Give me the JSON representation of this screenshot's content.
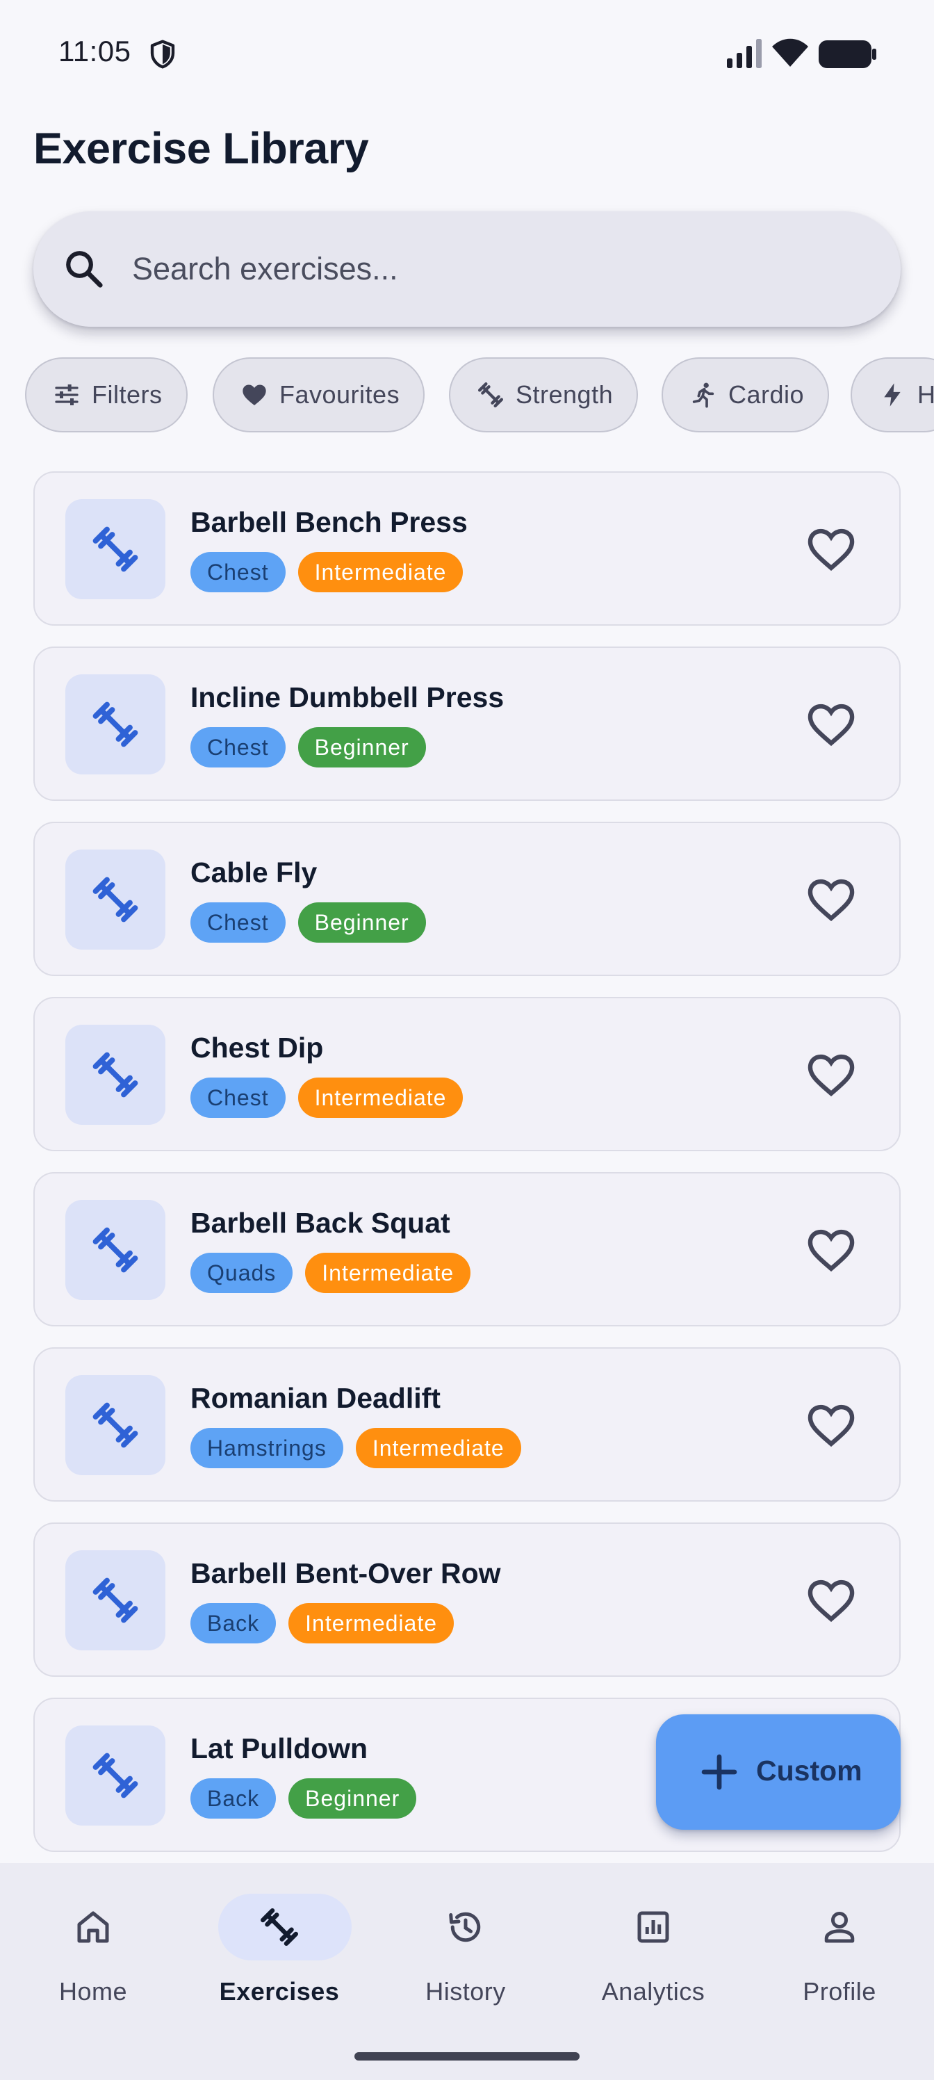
{
  "status_bar": {
    "time": "11:05"
  },
  "page": {
    "title": "Exercise Library"
  },
  "search": {
    "placeholder": "Search exercises..."
  },
  "chips": [
    {
      "label": "Filters",
      "icon": "tune-icon"
    },
    {
      "label": "Favourites",
      "icon": "heart-filled-icon"
    },
    {
      "label": "Strength",
      "icon": "dumbbell-icon"
    },
    {
      "label": "Cardio",
      "icon": "running-icon"
    },
    {
      "label": "H",
      "icon": "bolt-icon"
    }
  ],
  "exercises": [
    {
      "name": "Barbell Bench Press",
      "muscle": "Chest",
      "level": "Intermediate"
    },
    {
      "name": "Incline Dumbbell Press",
      "muscle": "Chest",
      "level": "Beginner"
    },
    {
      "name": "Cable Fly",
      "muscle": "Chest",
      "level": "Beginner"
    },
    {
      "name": "Chest Dip",
      "muscle": "Chest",
      "level": "Intermediate"
    },
    {
      "name": "Barbell Back Squat",
      "muscle": "Quads",
      "level": "Intermediate"
    },
    {
      "name": "Romanian Deadlift",
      "muscle": "Hamstrings",
      "level": "Intermediate"
    },
    {
      "name": "Barbell Bent-Over Row",
      "muscle": "Back",
      "level": "Intermediate"
    },
    {
      "name": "Lat Pulldown",
      "muscle": "Back",
      "level": "Beginner"
    }
  ],
  "fab": {
    "label": "Custom",
    "icon": "plus-icon"
  },
  "nav": [
    {
      "label": "Home",
      "icon": "home-icon",
      "active": false
    },
    {
      "label": "Exercises",
      "icon": "dumbbell-icon",
      "active": true
    },
    {
      "label": "History",
      "icon": "history-icon",
      "active": false
    },
    {
      "label": "Analytics",
      "icon": "analytics-icon",
      "active": false
    },
    {
      "label": "Profile",
      "icon": "person-icon",
      "active": false
    }
  ],
  "colors": {
    "accent": "#5c9cf4",
    "muscle_tag": "#5ea3f5",
    "intermediate_tag": "#ff8f0f",
    "beginner_tag": "#43a047",
    "thumb_bg": "#dce2f8"
  }
}
